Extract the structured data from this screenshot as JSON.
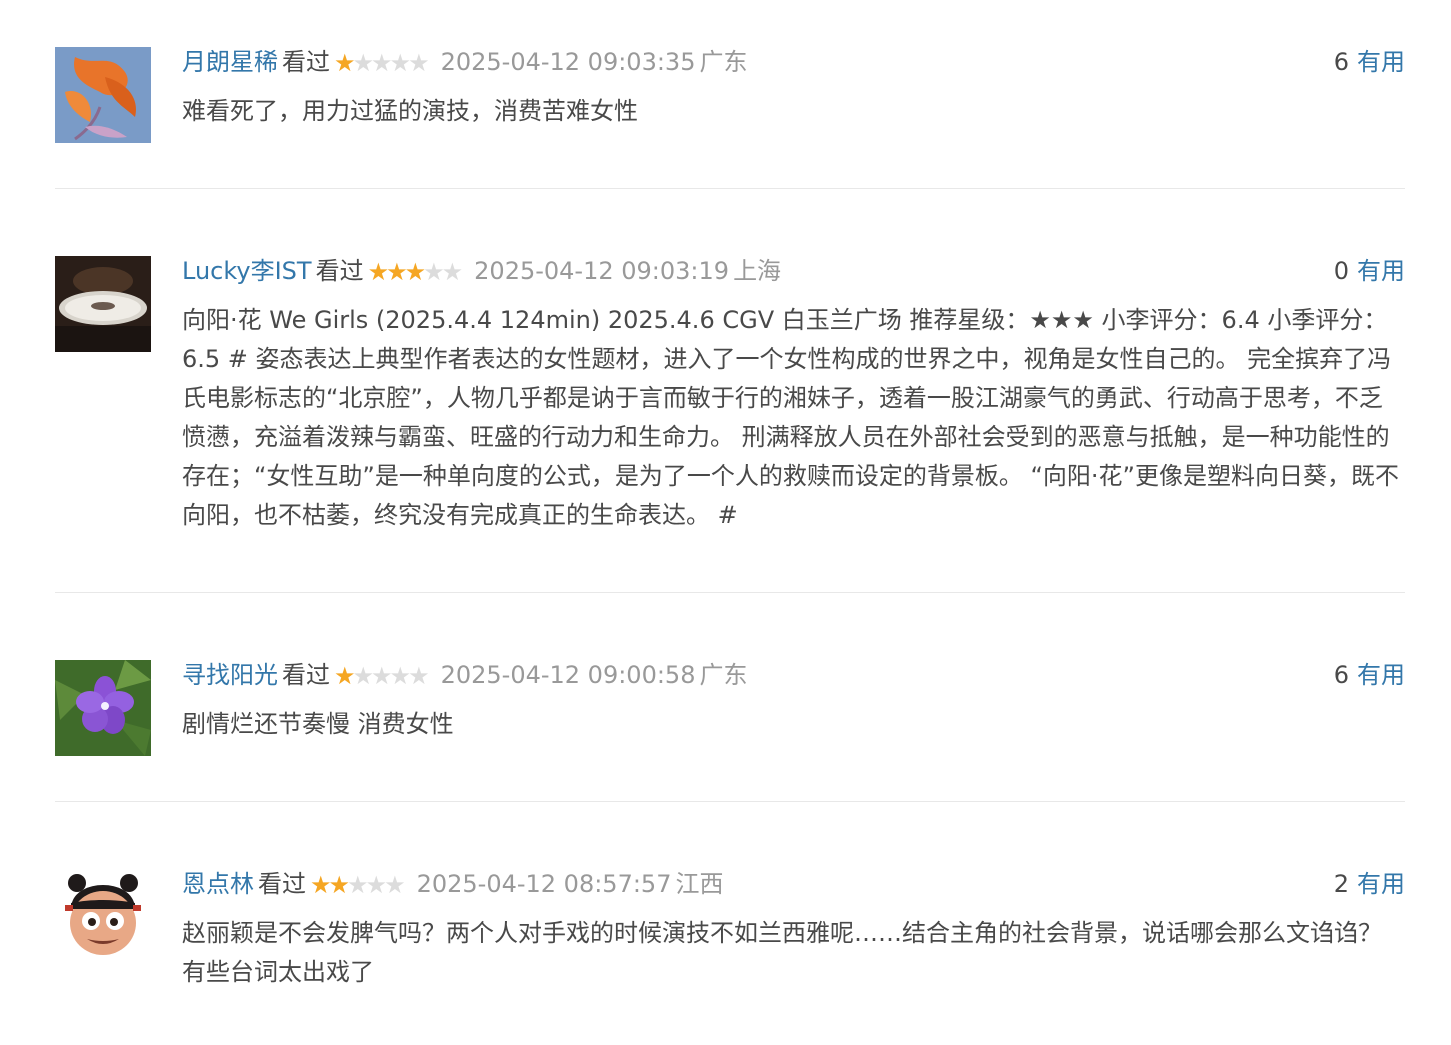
{
  "comments": [
    {
      "user": "月朗星稀",
      "status": "看过",
      "rating": 1,
      "rating_max": 5,
      "time": "2025-04-12 09:03:35",
      "location": "广东",
      "votes": "6",
      "vote_label": "有用",
      "text": "难看死了，用力过猛的演技，消费苦难女性",
      "avatar_icon": "orange-lily-avatar"
    },
    {
      "user": "Lucky李IST",
      "status": "看过",
      "rating": 3,
      "rating_max": 5,
      "time": "2025-04-12 09:03:19",
      "location": "上海",
      "votes": "0",
      "vote_label": "有用",
      "text": "向阳·花 We Girls (2025.4.4 124min) 2025.4.6 CGV 白玉兰广场 推荐星级：★★★ 小李评分：6.4 小季评分：6.5 # 姿态表达上典型作者表达的女性题材，进入了一个女性构成的世界之中，视角是女性自己的。 完全摈弃了冯氏电影标志的“北京腔”，人物几乎都是讷于言而敏于行的湘妹子，透着一股江湖豪气的勇武、行动高于思考，不乏愤懑，充溢着泼辣与霸蛮、旺盛的行动力和生命力。 刑满释放人员在外部社会受到的恶意与抵触，是一种功能性的存在；“女性互助”是一种单向度的公式，是为了一个人的救赎而设定的背景板。 “向阳·花”更像是塑料向日葵，既不向阳，也不枯萎，终究没有完成真正的生命表达。 #",
      "avatar_icon": "vinyl-record-avatar"
    },
    {
      "user": "寻找阳光",
      "status": "看过",
      "rating": 1,
      "rating_max": 5,
      "time": "2025-04-12 09:00:58",
      "location": "广东",
      "votes": "6",
      "vote_label": "有用",
      "text": "剧情烂还节奏慢 消费女性",
      "avatar_icon": "purple-flower-avatar"
    },
    {
      "user": "恩点林",
      "status": "看过",
      "rating": 2,
      "rating_max": 5,
      "time": "2025-04-12 08:57:57",
      "location": "江西",
      "votes": "2",
      "vote_label": "有用",
      "text": "赵丽颖是不会发脾气吗？两个人对手戏的时候演技不如兰西雅呢……结合主角的社会背景，说话哪会那么文诌诌？有些台词太出戏了",
      "avatar_icon": "cartoon-character-avatar"
    }
  ],
  "colors": {
    "link": "#3377aa",
    "star": "#f5a623",
    "star_empty": "#dcdcdc",
    "meta": "#999999",
    "text": "#494949",
    "divider": "#e8e8e8"
  }
}
